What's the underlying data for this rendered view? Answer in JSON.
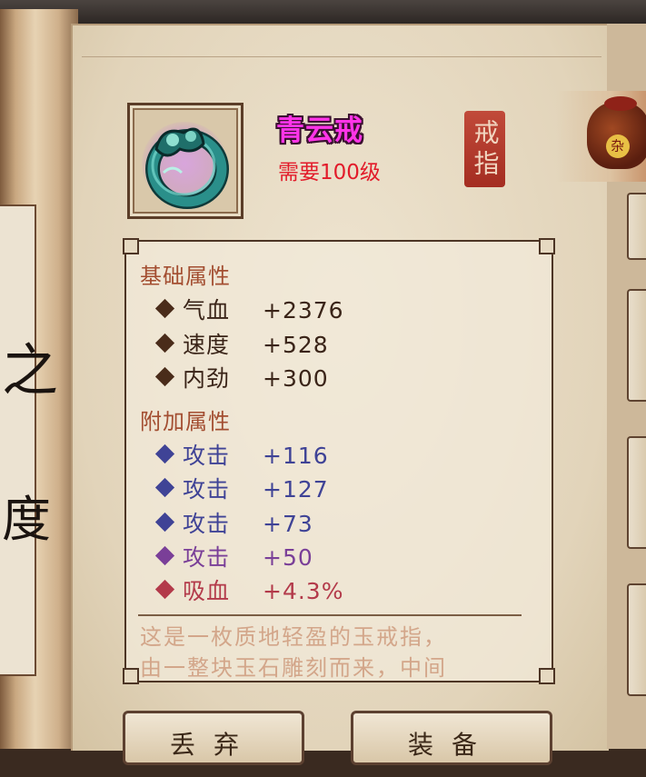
{
  "item": {
    "name": "青云戒",
    "requirement": "需要100级",
    "type_seal": "戒指"
  },
  "base_section": {
    "title": "基础属性",
    "stats": [
      {
        "name": "气血",
        "value": "+2376",
        "color": "#3a2418"
      },
      {
        "name": "速度",
        "value": "+528",
        "color": "#3a2418"
      },
      {
        "name": "内劲",
        "value": "+300",
        "color": "#3a2418"
      }
    ]
  },
  "extra_section": {
    "title": "附加属性",
    "stats": [
      {
        "name": "攻击",
        "value": "+116",
        "color": "#3f4396"
      },
      {
        "name": "攻击",
        "value": "+127",
        "color": "#3f4396"
      },
      {
        "name": "攻击",
        "value": "+73",
        "color": "#3f4396"
      },
      {
        "name": "攻击",
        "value": "+50",
        "color": "#7a3f98"
      },
      {
        "name": "吸血",
        "value": "+4.3%",
        "color": "#b33a4a"
      }
    ]
  },
  "description": {
    "line1": "这是一枚质地轻盈的玉戒指，",
    "line2": "由一整块玉石雕刻而来，中间"
  },
  "buttons": {
    "discard": "丢弃",
    "equip": "装备"
  },
  "left_scroll_text": {
    "char1": "之",
    "char2": "度"
  },
  "jar_label": "杂",
  "colors": {
    "title": "#ff34e8",
    "requirement": "#e21b2a",
    "section_title": "#a34e31",
    "seal": "#b63a2b"
  }
}
